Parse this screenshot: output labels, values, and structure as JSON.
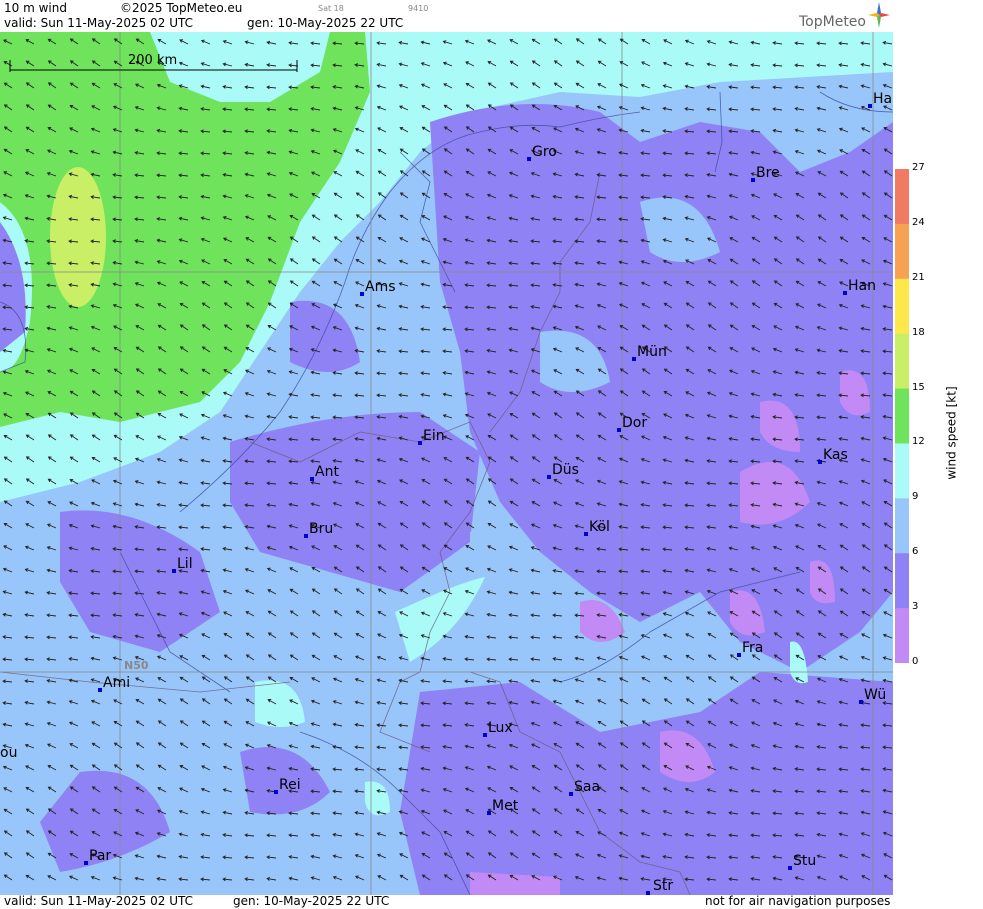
{
  "header": {
    "product": "10 m wind",
    "copyright": "©2025 TopMeteo.eu",
    "sat_label": "Sat 18",
    "code": "9410",
    "valid": "valid:  Sun  11-May-2025  02 UTC",
    "gen": "gen: 10-May-2025 22 UTC",
    "logo": "TopMeteo"
  },
  "footer": {
    "valid": "valid:  Sun  11-May-2025  02 UTC",
    "gen": "gen: 10-May-2025 22 UTC",
    "disclaimer": "not for air navigation purposes"
  },
  "map": {
    "scale_label": "200 km",
    "lat_label": "N50",
    "cities": [
      "Gro",
      "Bre",
      "Ha",
      "Ams",
      "Han",
      "Mün",
      "Dor",
      "Ein",
      "Kas",
      "Ant",
      "Düs",
      "Köl",
      "Bru",
      "Lil",
      "Fra",
      "Ami",
      "Wü",
      "Lux",
      "ou",
      "Rei",
      "Saa",
      "Met",
      "Stu",
      "Par",
      "Str"
    ]
  },
  "legend": {
    "title": "wind speed [kt]",
    "ticks": [
      "27",
      "24",
      "21",
      "18",
      "15",
      "12",
      "9",
      "6",
      "3",
      "0"
    ],
    "colors": [
      "#f07a62",
      "#f7a155",
      "#fde84b",
      "#c8ef66",
      "#6fe35c",
      "#aafaf8",
      "#99c6fa",
      "#8f82f4",
      "#c28af4"
    ]
  }
}
